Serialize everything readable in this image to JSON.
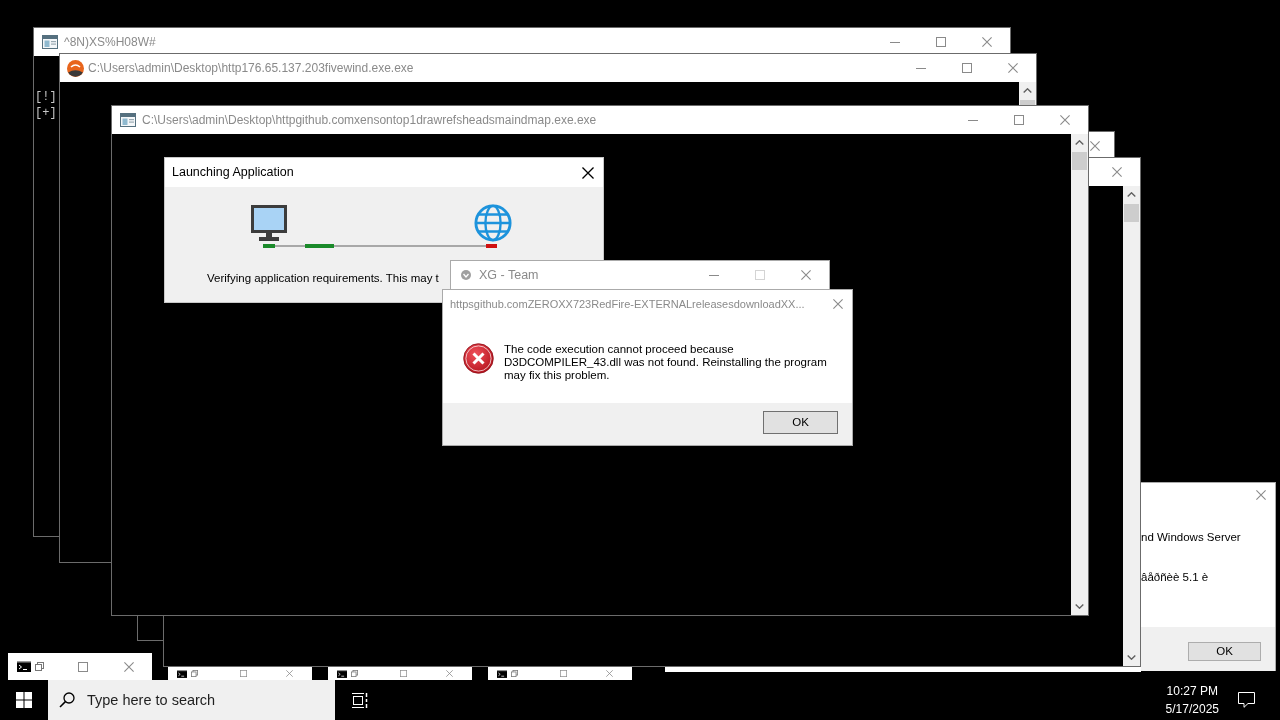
{
  "windows": [
    {
      "kind": "console",
      "title": "^8N)XS%H08W#",
      "active": false,
      "lines": [
        "[!]",
        "[+]"
      ]
    },
    {
      "kind": "app",
      "title": "C:\\Users\\admin\\Desktop\\http176.65.137.203fivewind.exe.exe",
      "active": false,
      "scrollbar": true
    },
    {
      "kind": "console",
      "title": "C:\\Users\\admin\\Desktop\\httpgithub.comxensontop1drawrefsheadsmaindmap.exe.exe",
      "active": false,
      "scrollbar": true
    },
    {
      "active": false
    },
    {
      "active": false,
      "scrollbar": true
    }
  ],
  "launch_dialog": {
    "title": "Launching Application",
    "active": true,
    "message": "Verifying application requirements. This may t"
  },
  "xg_window": {
    "title": "XG - Team",
    "active": false,
    "maximize_disabled": true
  },
  "error_dialog": {
    "title": "httpsgithub.comZEROXX723RedFire-EXTERNALreleasesdownloadXX...",
    "active": false,
    "message": "The code execution cannot proceed because D3DCOMPILER_43.dll was not found. Reinstalling the program may fix this problem.",
    "buttons": [
      "OK"
    ]
  },
  "background_dialog": {
    "lines": [
      "nd Windows Server",
      "âåðñèè 5.1 è"
    ],
    "buttons": [
      "OK"
    ]
  },
  "minimized_windows": [
    {
      "kind": "console"
    },
    {
      "kind": "console"
    },
    {
      "kind": "console"
    },
    {
      "kind": "console"
    }
  ],
  "taskbar": {
    "search": {
      "placeholder": "Type here to search"
    },
    "clock": {
      "time": "10:27 PM",
      "date": "5/17/2025"
    }
  }
}
